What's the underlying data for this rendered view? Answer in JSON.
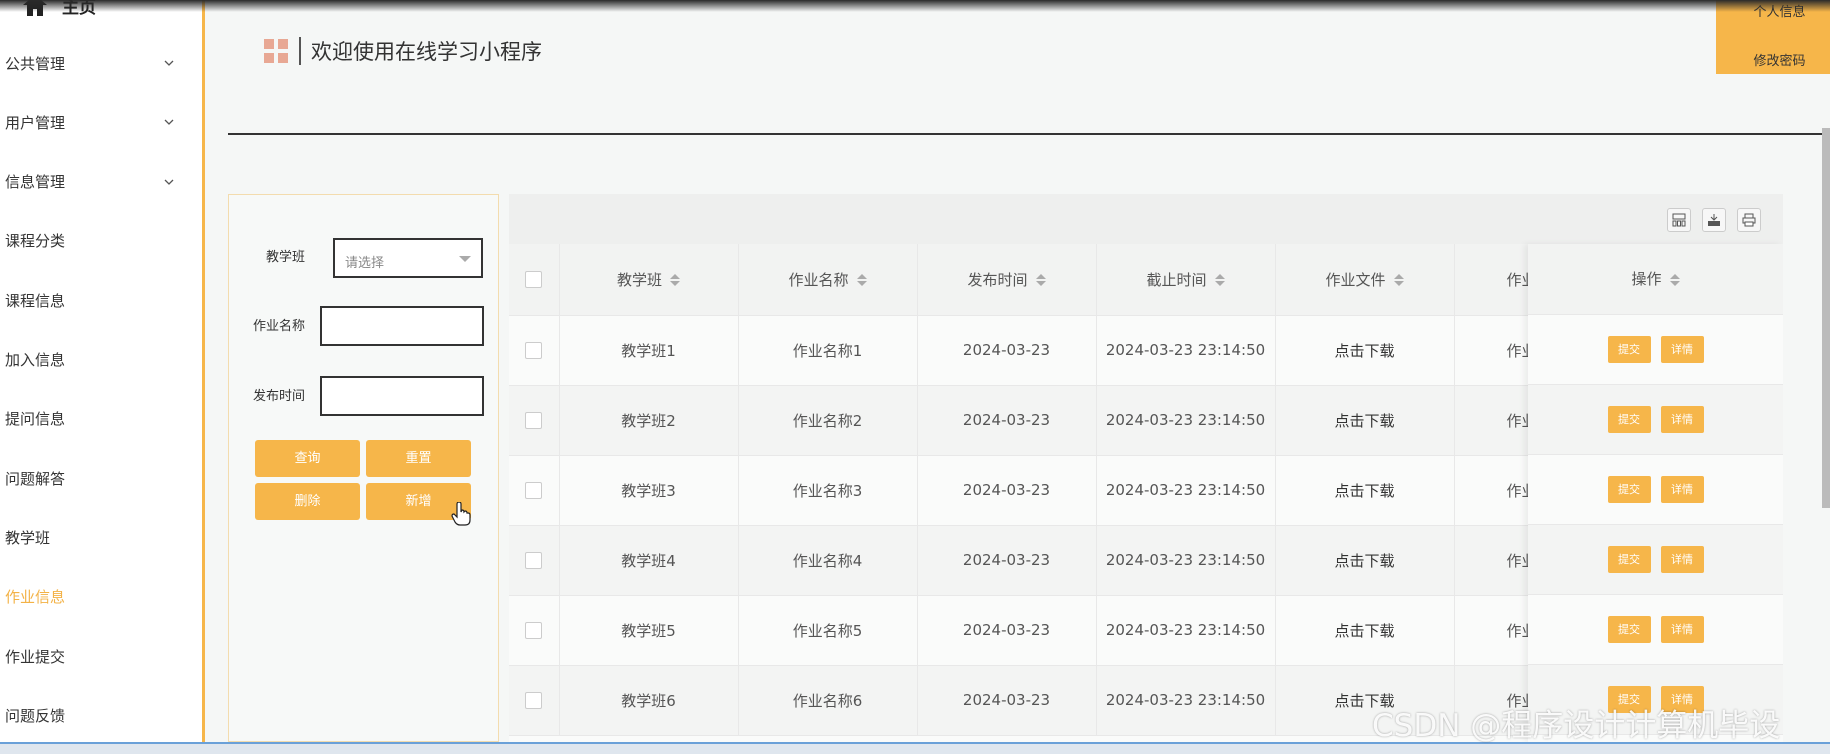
{
  "colors": {
    "accent": "#f6b64a",
    "active_nav": "#f3b246",
    "sidebar_bg": "#ffffff"
  },
  "sidebar": {
    "home_label": "主页",
    "home_icon": "home-icon",
    "items": [
      {
        "label": "公共管理",
        "has_chevron": true,
        "active": false
      },
      {
        "label": "用户管理",
        "has_chevron": true,
        "active": false
      },
      {
        "label": "信息管理",
        "has_chevron": true,
        "active": false
      },
      {
        "label": "课程分类",
        "has_chevron": false,
        "active": false
      },
      {
        "label": "课程信息",
        "has_chevron": false,
        "active": false
      },
      {
        "label": "加入信息",
        "has_chevron": false,
        "active": false
      },
      {
        "label": "提问信息",
        "has_chevron": false,
        "active": false
      },
      {
        "label": "问题解答",
        "has_chevron": false,
        "active": false
      },
      {
        "label": "教学班",
        "has_chevron": false,
        "active": false
      },
      {
        "label": "作业信息",
        "has_chevron": false,
        "active": true
      },
      {
        "label": "作业提交",
        "has_chevron": false,
        "active": false
      },
      {
        "label": "问题反馈",
        "has_chevron": false,
        "active": false
      }
    ]
  },
  "header": {
    "title": "欢迎使用在线学习小程序",
    "profile_label": "个人信息",
    "change_password_label": "修改密码"
  },
  "filter": {
    "class_label": "教学班",
    "class_placeholder": "请选择",
    "name_label": "作业名称",
    "time_label": "发布时间",
    "query_button": "查询",
    "reset_button": "重置",
    "delete_button": "删除",
    "add_button": "新增"
  },
  "table": {
    "toolbar_icons": [
      "columns-icon",
      "export-icon",
      "print-icon"
    ],
    "columns": [
      "教学班",
      "作业名称",
      "发布时间",
      "截止时间",
      "作业文件",
      "作业"
    ],
    "action_column": "操作",
    "submit_label": "提交",
    "detail_label": "详情",
    "rows": [
      {
        "class": "教学班1",
        "name": "作业名称1",
        "publish": "2024-03-23",
        "deadline": "2024-03-23 23:14:50",
        "file": "点击下载",
        "extra": "作业"
      },
      {
        "class": "教学班2",
        "name": "作业名称2",
        "publish": "2024-03-23",
        "deadline": "2024-03-23 23:14:50",
        "file": "点击下载",
        "extra": "作业"
      },
      {
        "class": "教学班3",
        "name": "作业名称3",
        "publish": "2024-03-23",
        "deadline": "2024-03-23 23:14:50",
        "file": "点击下载",
        "extra": "作业"
      },
      {
        "class": "教学班4",
        "name": "作业名称4",
        "publish": "2024-03-23",
        "deadline": "2024-03-23 23:14:50",
        "file": "点击下载",
        "extra": "作业"
      },
      {
        "class": "教学班5",
        "name": "作业名称5",
        "publish": "2024-03-23",
        "deadline": "2024-03-23 23:14:50",
        "file": "点击下载",
        "extra": "作业"
      },
      {
        "class": "教学班6",
        "name": "作业名称6",
        "publish": "2024-03-23",
        "deadline": "2024-03-23 23:14:50",
        "file": "点击下载",
        "extra": "作业"
      }
    ]
  },
  "watermark": "CSDN @程序设计计算机毕设"
}
